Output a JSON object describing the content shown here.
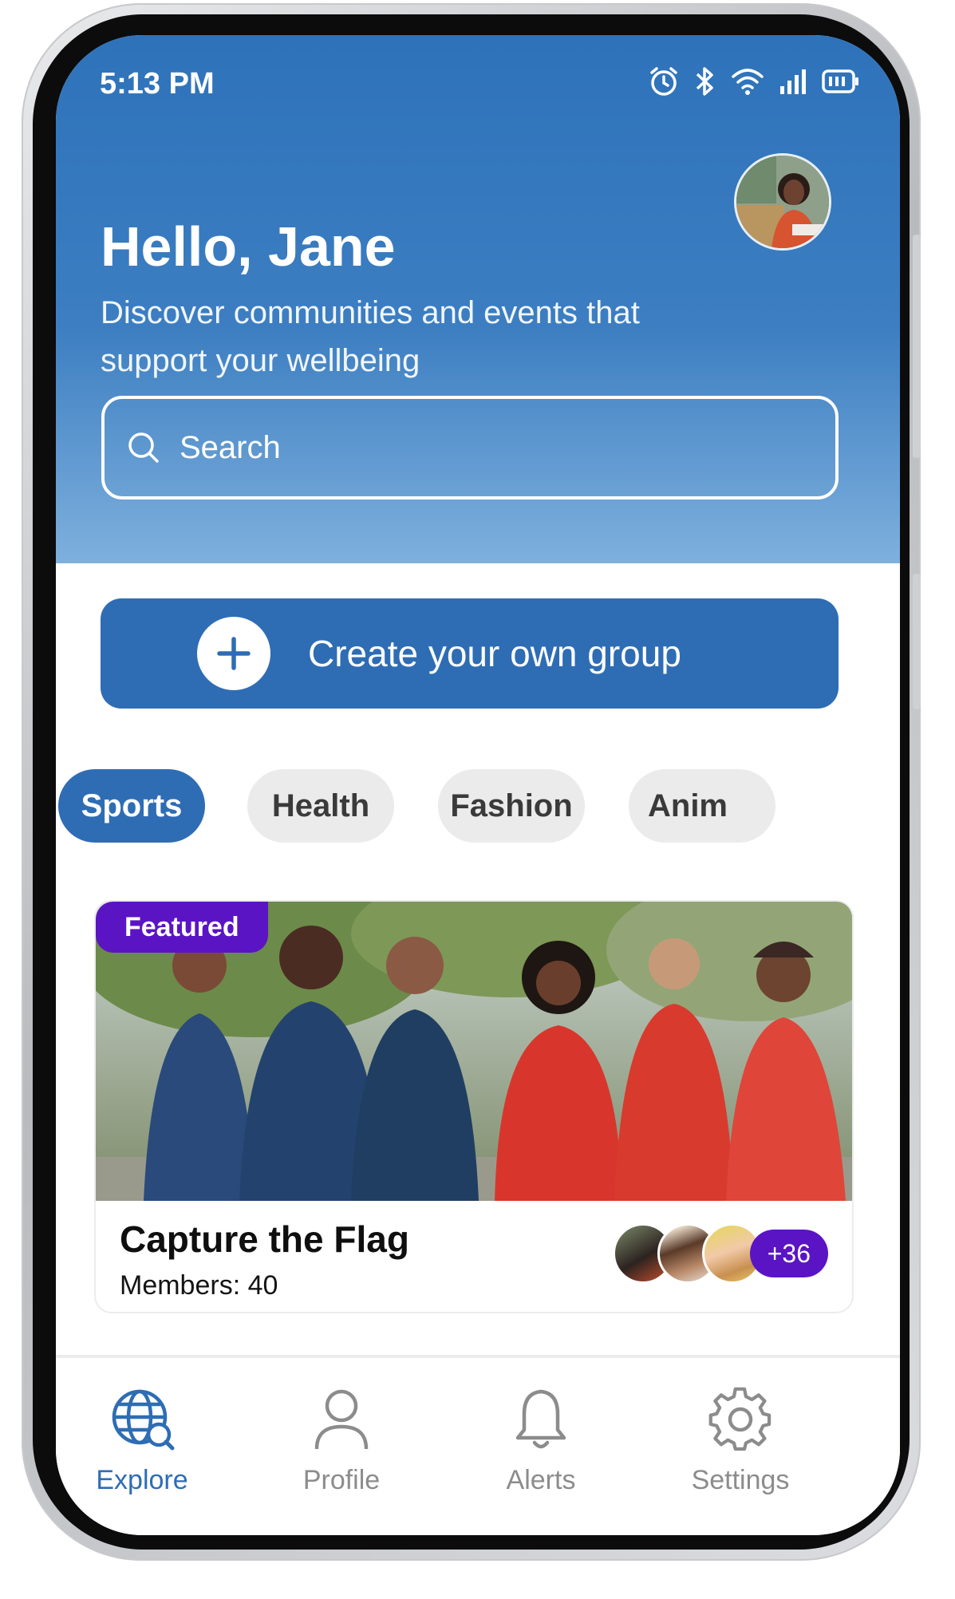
{
  "status_bar": {
    "time": "5:13 PM"
  },
  "header": {
    "greeting": "Hello, Jane",
    "subtitle": "Discover communities and events that support your wellbeing"
  },
  "search": {
    "placeholder": "Search"
  },
  "create_group": {
    "label": "Create your own group"
  },
  "categories": [
    {
      "label": "Sports",
      "active": true
    },
    {
      "label": "Health",
      "active": false
    },
    {
      "label": "Fashion",
      "active": false
    },
    {
      "label": "Anim",
      "active": false
    }
  ],
  "featured_card": {
    "badge": "Featured",
    "title": "Capture the Flag",
    "members_label": "Members:",
    "members_count": "40",
    "extra_members": "+36"
  },
  "tabs": [
    {
      "label": "Explore",
      "icon": "globe-search-icon",
      "active": true
    },
    {
      "label": "Profile",
      "icon": "user-icon",
      "active": false
    },
    {
      "label": "Alerts",
      "icon": "bell-icon",
      "active": false
    },
    {
      "label": "Settings",
      "icon": "gear-icon",
      "active": false
    }
  ],
  "colors": {
    "primary": "#2e6db4",
    "featured": "#5b14c4",
    "header_top": "#2e72ba",
    "header_bottom": "#7eb0dd"
  }
}
